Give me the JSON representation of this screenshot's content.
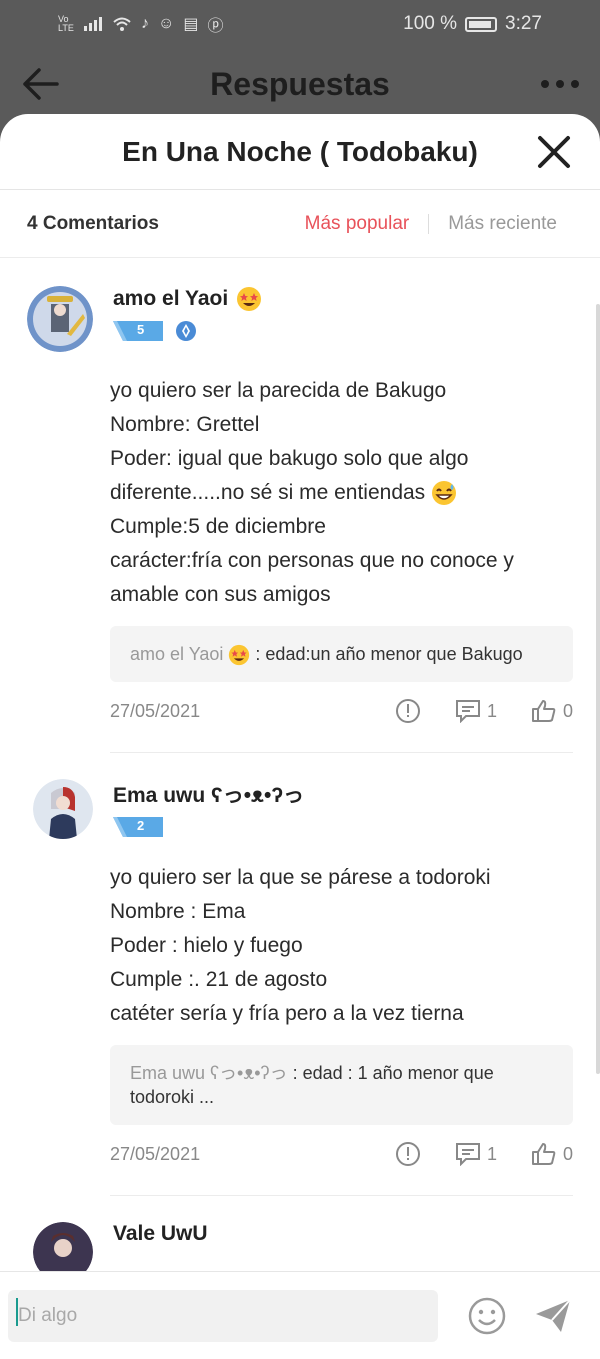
{
  "status": {
    "battery": "100 %",
    "time": "3:27",
    "carrier": "Vo LTE"
  },
  "app_header": {
    "title": "Respuestas"
  },
  "sheet": {
    "title": "En Una Noche ( Todobaku)"
  },
  "tabs": {
    "count": "4 Comentarios",
    "popular": "Más popular",
    "recent": "Más reciente"
  },
  "comments": [
    {
      "username": "amo el Yaoi",
      "level": "5",
      "body": "yo quiero ser la parecida de Bakugo\nNombre: Grettel\nPoder: igual que bakugo solo que algo diferente.....no sé si me entiendas",
      "body_tail": "Cumple:5 de diciembre\ncarácter:fría con personas que no conoce y amable con sus amigos",
      "reply_author": "amo el Yaoi",
      "reply_text": " : edad:un año menor que Bakugo",
      "date": "27/05/2021",
      "reply_count": "1",
      "like_count": "0"
    },
    {
      "username": "Ema uwu ʕっ•ᴥ•ʔっ",
      "level": "2",
      "body": "yo quiero ser la que se párese a todoroki\nNombre :   Ema\nPoder :   hielo y fuego\nCumple :. 21 de agosto\ncatéter sería y fría pero a la vez tierna",
      "reply_author": "Ema uwu ʕっ•ᴥ•ʔっ",
      "reply_text": " : edad : 1 año menor que todoroki ...",
      "date": "27/05/2021",
      "reply_count": "1",
      "like_count": "0"
    },
    {
      "username": "Vale UwU"
    }
  ],
  "composer": {
    "placeholder": "Di algo"
  },
  "colors": {
    "accent": "#e8525a",
    "badge": "#5aa9e6",
    "caret": "#1a9b8f"
  }
}
